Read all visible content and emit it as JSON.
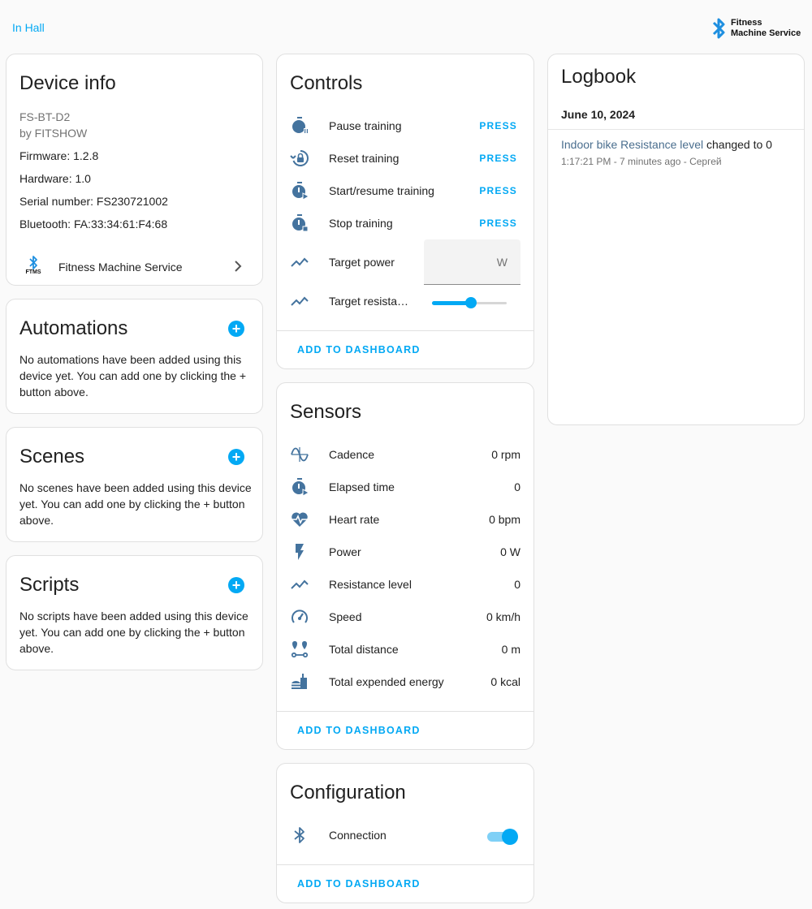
{
  "breadcrumb": "In Hall",
  "brand": {
    "line1": "Fitness",
    "line2": "Machine Service"
  },
  "device_info": {
    "title": "Device info",
    "model": "FS-BT-D2",
    "manufacturer": "by FITSHOW",
    "firmware": "Firmware: 1.2.8",
    "hardware": "Hardware: 1.0",
    "serial": "Serial number: FS230721002",
    "bluetooth": "Bluetooth: FA:33:34:61:F4:68",
    "integration": {
      "logo_text": "FTMS",
      "label": "Fitness Machine Service"
    }
  },
  "automations": {
    "title": "Automations",
    "text": "No automations have been added using this device yet. You can add one by clicking the + button above."
  },
  "scenes": {
    "title": "Scenes",
    "text": "No scenes have been added using this device yet. You can add one by clicking the + button above."
  },
  "scripts": {
    "title": "Scripts",
    "text": "No scripts have been added using this device yet. You can add one by clicking the + button above."
  },
  "controls": {
    "title": "Controls",
    "items": [
      {
        "label": "Pause training",
        "action": "PRESS"
      },
      {
        "label": "Reset training",
        "action": "PRESS"
      },
      {
        "label": "Start/resume training",
        "action": "PRESS"
      },
      {
        "label": "Stop training",
        "action": "PRESS"
      }
    ],
    "target_power": {
      "label": "Target power",
      "unit": "W"
    },
    "target_resistance": {
      "label": "Target resista…",
      "level_fraction": 0.52
    },
    "add_to_dashboard": "ADD TO DASHBOARD"
  },
  "sensors": {
    "title": "Sensors",
    "items": [
      {
        "label": "Cadence",
        "value": "0 rpm"
      },
      {
        "label": "Elapsed time",
        "value": "0"
      },
      {
        "label": "Heart rate",
        "value": "0 bpm"
      },
      {
        "label": "Power",
        "value": "0 W"
      },
      {
        "label": "Resistance level",
        "value": "0"
      },
      {
        "label": "Speed",
        "value": "0 km/h"
      },
      {
        "label": "Total distance",
        "value": "0 m"
      },
      {
        "label": "Total expended energy",
        "value": "0 kcal"
      }
    ],
    "add_to_dashboard": "ADD TO DASHBOARD"
  },
  "configuration": {
    "title": "Configuration",
    "connection": {
      "label": "Connection",
      "state": "on"
    },
    "add_to_dashboard": "ADD TO DASHBOARD"
  },
  "logbook": {
    "title": "Logbook",
    "date": "June 10, 2024",
    "entry": {
      "link": "Indoor bike Resistance level",
      "text": " changed to 0",
      "meta": "1:17:21 PM - 7 minutes ago - Сергей"
    }
  },
  "colors": {
    "accent": "#03a9f4",
    "icon": "#44739e",
    "background": "#fafafa"
  }
}
